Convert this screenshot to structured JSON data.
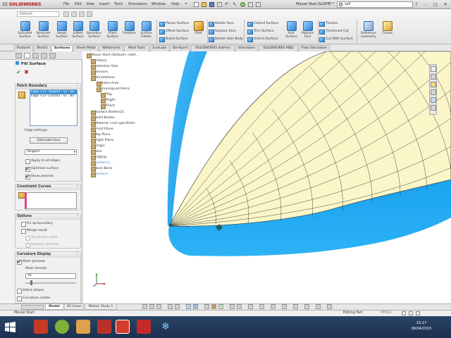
{
  "titlebar": {
    "logo_brand": "SOLIDWORKS",
    "logo_prefix": "3S",
    "menus": [
      "File",
      "Edit",
      "View",
      "Insert",
      "Tools",
      "Simulation",
      "Window",
      "Help"
    ],
    "document_title": "Mouse Start.SLDPRT *",
    "search_value": "spli"
  },
  "command_manager": {
    "config_value": "Default",
    "big_tools": [
      "Extruded Surface",
      "Revolved Surface",
      "Swept Surface",
      "Lofted Surface",
      "Boundary Surface",
      "Filled Surface",
      "Freeform",
      "Surface Flatten"
    ],
    "small_tools_col1": [
      "Planar Surface",
      "Offset Surface",
      "Ruled Surface"
    ],
    "fillet_label": "Fillet",
    "small_tools_col2": [
      "Delete Face",
      "Replace Face",
      "Delete Hole Body"
    ],
    "small_tools_col3": [
      "Extend Surface",
      "Trim Surface",
      "Untrim Surface"
    ],
    "knit_label": "Knit Surface",
    "replace_face_label": "Replace Face",
    "small_tools_col4": [
      "Thicken",
      "Thickened Cut",
      "Cut With Surface"
    ],
    "ref_geom_label": "Reference Geometry",
    "curves_label": "Curves"
  },
  "tabs": [
    "Features",
    "Sketch",
    "Surfaces",
    "Sheet Metal",
    "Weldments",
    "Mold Tools",
    "Evaluate",
    "DimXpert",
    "SOLIDWORKS Add-Ins",
    "Simulation",
    "SOLIDWORKS MBD",
    "Flow Simulation"
  ],
  "property_manager": {
    "title": "Fill Surface",
    "ok_glyph": "✔",
    "cancel_glyph": "✖",
    "patch_boundary": {
      "heading": "Patch Boundary",
      "edges": [
        "Edge <1> Tangent - S1 - Bo",
        "Edge <2> Contact - S1 - Bo"
      ],
      "edge_settings_label": "Edge settings:",
      "alternate_face_label": "Alternate Face",
      "continuity_value": "Tangent",
      "apply_all_edges": "Apply to all edges",
      "optimize_surface": "Optimize surface",
      "show_preview": "Show preview"
    },
    "constraint_curves": {
      "heading": "Constraint Curves"
    },
    "options": {
      "heading": "Options",
      "fix_up_boundary": "Fix up boundary",
      "merge_result": "Merge result",
      "try_to_form_solid": "Try to form solid",
      "reverse_direction": "Reverse direction"
    },
    "curvature_display": {
      "heading": "Curvature Display",
      "mesh_preview": "Mesh preview",
      "mesh_density_label": "Mesh density",
      "mesh_density_value": "16",
      "mesh_density_level": 0.1,
      "zebra_stripes": "Zebra stripes",
      "curvature_combs": "Curvature combs"
    }
  },
  "feature_tree": {
    "root": "Mouse Start (Default<<Def...",
    "items": [
      "History",
      "Selection Sets",
      "Sensors",
      "Annotations",
      "Notes Area",
      "Unassigned Items",
      "*Top",
      "*Right",
      "*Front",
      "Surface Bodies(2)",
      "Solid Bodies",
      "Material <not specified>",
      "Front Plane",
      "Top Plane",
      "Right Plane",
      "Origin",
      "Size",
      "Edging",
      "Surface-L...",
      "Back Bone",
      "Surface-..."
    ]
  },
  "bottom_tabs": [
    "Model",
    "3D Views",
    "Motion Study 1"
  ],
  "status_bar": {
    "left": "Mouse Start",
    "mode": "Editing Part",
    "units": "MMGS"
  },
  "taskbar": {
    "time": "15:17",
    "date": "08/04/2015"
  },
  "colors": {
    "surface_blue": "#1aa3f0",
    "mesh_fill": "#fbf6c8",
    "accent_red": "#b0121a"
  }
}
